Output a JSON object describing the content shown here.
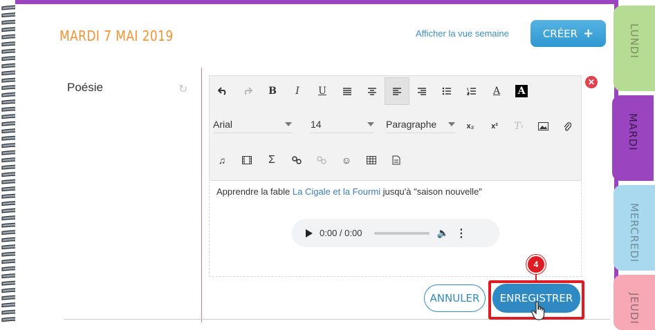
{
  "header": {
    "date": "MARDI 7 MAI 2019",
    "week_view_link": "Afficher la vue semaine",
    "create_button": "CRÉER",
    "create_icon": "plus-icon"
  },
  "day_tabs": [
    {
      "label": "LUNDI",
      "color": "#b5dc92"
    },
    {
      "label": "MARDI",
      "color": "#9a44c0"
    },
    {
      "label": "MERCREDI",
      "color": "#a9d9ef"
    },
    {
      "label": "JEUDI",
      "color": "#f7a8b4"
    }
  ],
  "subject": {
    "label": "Poésie",
    "refresh_icon": "refresh-icon"
  },
  "toolbar": {
    "row1": [
      "undo-icon",
      "redo-icon",
      "B",
      "I",
      "U",
      "align-justify-icon",
      "align-center-icon",
      "align-left-icon",
      "align-right-icon",
      "bullet-list-icon",
      "numbered-list-icon",
      "A",
      "A"
    ],
    "font_family": "Arial",
    "font_size": "14",
    "block_format": "Paragraphe",
    "subscript": "x₂",
    "superscript": "x²",
    "row3": [
      "music-icon",
      "film-icon",
      "sigma-icon",
      "link-icon",
      "unlink-icon",
      "emoji-icon",
      "table-icon",
      "document-icon"
    ]
  },
  "content": {
    "text_before": "Apprendre la fable",
    "link_text": "La Cigale et la Fourmi",
    "text_after": "jusqu'à \"saison nouvelle\""
  },
  "audio": {
    "time": "0:00 / 0:00"
  },
  "actions": {
    "cancel_button": "ANNULER",
    "save_button": "ENREGISTRER",
    "step_number": "4"
  },
  "colors": {
    "accent_purple": "#9a44c0",
    "date_orange": "#f59333",
    "primary_blue": "#2f8ac4",
    "highlight_red": "#e01b24"
  }
}
